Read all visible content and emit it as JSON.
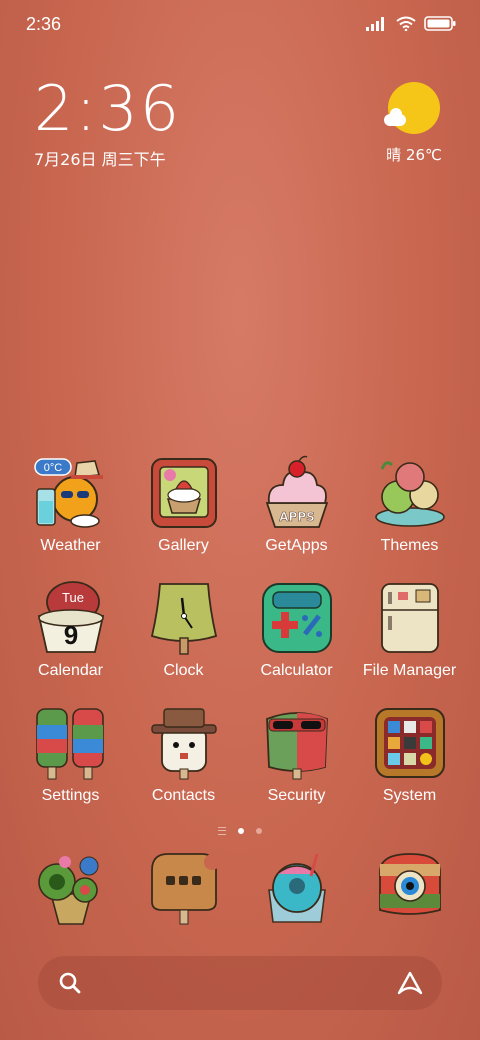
{
  "status_bar": {
    "time": "2:36"
  },
  "clock_widget": {
    "time": "2:36",
    "date": "7月26日 周三下午"
  },
  "weather_widget": {
    "text": "晴 26℃"
  },
  "apps": [
    {
      "label": "Weather",
      "icon": "weather-icon",
      "badge": "0°C"
    },
    {
      "label": "Gallery",
      "icon": "gallery-icon"
    },
    {
      "label": "GetApps",
      "icon": "getapps-icon",
      "badge": "APPS"
    },
    {
      "label": "Themes",
      "icon": "themes-icon"
    },
    {
      "label": "Calendar",
      "icon": "calendar-icon",
      "day": "Tue",
      "date": "9"
    },
    {
      "label": "Clock",
      "icon": "clock-icon"
    },
    {
      "label": "Calculator",
      "icon": "calculator-icon"
    },
    {
      "label": "File Manager",
      "icon": "file-manager-icon"
    },
    {
      "label": "Settings",
      "icon": "settings-icon"
    },
    {
      "label": "Contacts",
      "icon": "contacts-icon"
    },
    {
      "label": "Security",
      "icon": "security-icon"
    },
    {
      "label": "System",
      "icon": "system-icon"
    }
  ],
  "dock": [
    {
      "icon": "phone-icon"
    },
    {
      "icon": "messages-icon"
    },
    {
      "icon": "browser-icon"
    },
    {
      "icon": "camera-icon"
    }
  ],
  "page_indicator": {
    "count": 2,
    "active": 0
  }
}
